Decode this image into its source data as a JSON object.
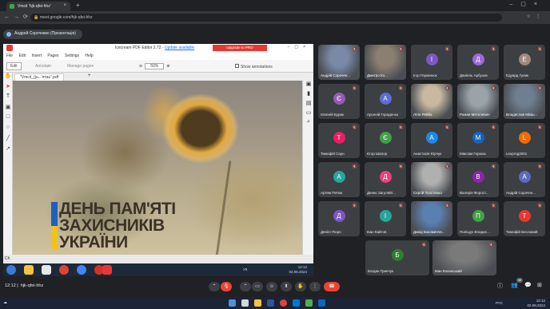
{
  "browser": {
    "tab_title": "Vmcit 'hjk-qfei-hhz'",
    "url": "meet.google.com/hjk-qfei-hhz"
  },
  "meet": {
    "presenter_label": "Андрей Сорочевко (Презентація)",
    "time": "12:12",
    "meeting_code": "hjk-qfei-hhz",
    "participant_count": "36"
  },
  "icecream": {
    "title": "Icecream PDF Editor 2.72 - Update available",
    "title_prefix": "Icecream PDF Editor 2.72 - ",
    "update_link": "Update available",
    "upgrade_button": "Upgrade to PRO",
    "menu": [
      "File",
      "Edit",
      "Insert",
      "Pages",
      "Settings",
      "Help"
    ],
    "edit_button": "Edit",
    "annotate_button": "Annotate",
    "manage_pages_button": "Manage pages",
    "zoom": "50%",
    "show_annotations_label": "Show annotations",
    "doc_tab": "\"Vmcit_(ju...'ятає\".pdf",
    "bottom_left": "Ch"
  },
  "slide": {
    "line1": "ДЕНЬ ПАМ'ЯТІ",
    "line2": "ЗАХИСНИКІВ",
    "line3": "УКРАЇНИ"
  },
  "inner_taskbar": {
    "lang": "УК",
    "time": "12:12",
    "date": "02.08.2024"
  },
  "participants": [
    {
      "name": "Андрій Сорочен...",
      "initial": "",
      "color": "#7a8aa6",
      "video": true
    },
    {
      "name": "Дмитро Ко...",
      "initial": "",
      "color": "#8a7f70",
      "video": true
    },
    {
      "name": "Ігор Германюк",
      "initial": "І",
      "color": "#7e57c2",
      "video": false
    },
    {
      "name": "Даніель Арбузов",
      "initial": "Д",
      "color": "#9c6ad6",
      "video": false
    },
    {
      "name": "Едуард Гулик",
      "initial": "Е",
      "color": "#a1887f",
      "video": false
    },
    {
      "name": "Євгеній Бурик",
      "initial": "Є",
      "color": "#9b59b6",
      "video": false
    },
    {
      "name": "Арсеній Гораденко",
      "initial": "А",
      "color": "#5e6bd8",
      "video": false
    },
    {
      "name": "Літія Рейба",
      "initial": "",
      "color": "#c8b8a0",
      "video": true
    },
    {
      "name": "Роман Метелевич",
      "initial": "",
      "color": "#9aa4a8",
      "video": true
    },
    {
      "name": "Владислав Мікіш...",
      "initial": "",
      "color": "#6f7f8f",
      "video": true
    },
    {
      "name": "Тимофій Саун",
      "initial": "Т",
      "color": "#e91e63",
      "video": false
    },
    {
      "name": "Єгор Шапор",
      "initial": "Є",
      "color": "#43a047",
      "video": false
    },
    {
      "name": "Анастасія Юрчук",
      "initial": "А",
      "color": "#1e88e5",
      "video": false
    },
    {
      "name": "Максим Горюха",
      "initial": "М",
      "color": "#1565c0",
      "video": false
    },
    {
      "name": "Lexprog2001",
      "initial": "L",
      "color": "#ef6c00",
      "video": false
    },
    {
      "name": "Артем Петюк",
      "initial": "А",
      "color": "#26a69a",
      "video": false
    },
    {
      "name": "Денис Загуляйт...",
      "initial": "Д",
      "color": "#ec407a",
      "video": false
    },
    {
      "name": "Сергій Толстенко",
      "initial": "",
      "color": "#b0b0b0",
      "video": true
    },
    {
      "name": "Валерія Форост...",
      "initial": "В",
      "color": "#8e24aa",
      "video": false
    },
    {
      "name": "Андрій Сорочен...",
      "initial": "А",
      "color": "#5c6bc0",
      "video": false
    },
    {
      "name": "Деніїл Пюро",
      "initial": "Д",
      "color": "#7e57c2",
      "video": false
    },
    {
      "name": "Іван Кайтов",
      "initial": "І",
      "color": "#26a69a",
      "video": false
    },
    {
      "name": "Давід Бокоменча...",
      "initial": "",
      "color": "#5a7fb0",
      "video": true
    },
    {
      "name": "Поліщук Владис...",
      "initial": "П",
      "color": "#43a047",
      "video": false
    },
    {
      "name": "Тимофій Бесланий",
      "initial": "Т",
      "color": "#e53935",
      "video": false
    },
    {
      "name": "Богдан Гринчук",
      "initial": "Б",
      "color": "#2e7d32",
      "video": false
    },
    {
      "name": "Іван Косинський",
      "initial": "",
      "color": "#7a7a7a",
      "video": true
    }
  ],
  "system": {
    "lang": "РУС",
    "time": "12:12",
    "date": "02.08.2024"
  }
}
